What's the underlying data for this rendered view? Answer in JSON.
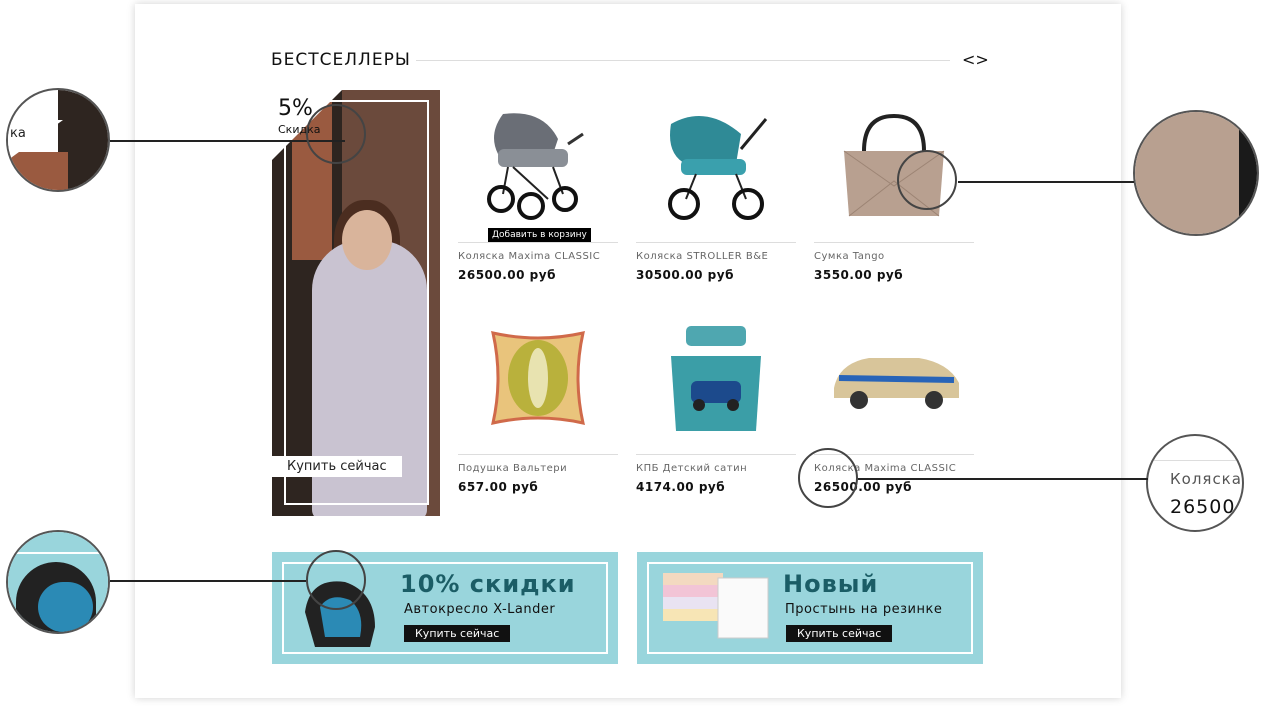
{
  "section": {
    "title": "БЕСТСЕЛЛЕРЫ",
    "prev_icon": "chevron-left-icon",
    "next_icon": "chevron-right-icon"
  },
  "promo": {
    "discount": "5%",
    "discount_label": "Скидка",
    "buy_label": "Купить сейчас"
  },
  "add_to_cart": "Добавить в корзину",
  "products": [
    {
      "name": "Коляска Maxima CLASSIC",
      "price": "26500.00 руб"
    },
    {
      "name": "Коляска STROLLER B&E",
      "price": "30500.00 руб"
    },
    {
      "name": "Сумка Tango",
      "price": "3550.00 руб"
    },
    {
      "name": "Подушка Вальтери",
      "price": "657.00 руб"
    },
    {
      "name": "КПБ Детский сатин",
      "price": "4174.00 руб"
    },
    {
      "name": "Коляска Maxima CLASSIC",
      "price": "26500.00 руб"
    }
  ],
  "banners": [
    {
      "heading": "10% скидки",
      "subtitle": "Автокресло X-Lander",
      "button": "Купить сейчас"
    },
    {
      "heading": "Новый",
      "subtitle": "Простынь на резинке",
      "button": "Купить сейчас"
    }
  ],
  "callouts": {
    "left_top_text": "ка",
    "right_bottom_name": "Коляска",
    "right_bottom_price": "26500."
  }
}
